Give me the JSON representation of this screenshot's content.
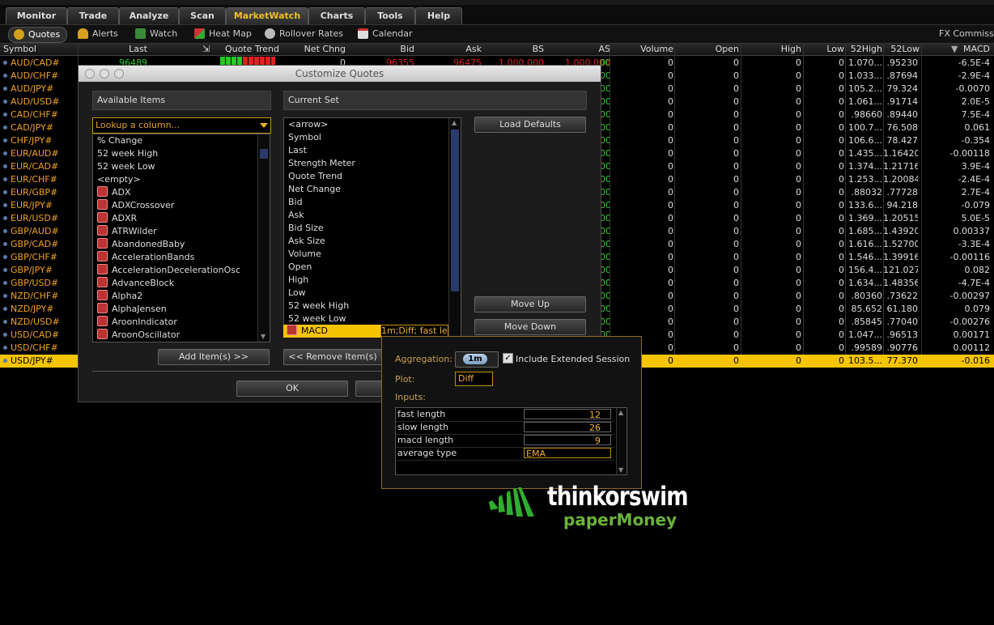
{
  "tabs": [
    "Monitor",
    "Trade",
    "Analyze",
    "Scan",
    "MarketWatch",
    "Charts",
    "Tools",
    "Help"
  ],
  "active_tab": "MarketWatch",
  "subtabs": [
    {
      "label": "Quotes",
      "icon": "quotes-icon"
    },
    {
      "label": "Alerts",
      "icon": "bell-icon"
    },
    {
      "label": "Watch",
      "icon": "watch-icon"
    },
    {
      "label": "Heat Map",
      "icon": "heatmap-icon"
    },
    {
      "label": "Rollover Rates",
      "icon": "rollover-icon"
    },
    {
      "label": "Calendar",
      "icon": "calendar-icon"
    }
  ],
  "fx_label": "FX Commissi",
  "columns": [
    "Symbol",
    "Last",
    "Quote Trend",
    "Net Chng",
    "Bid",
    "Ask",
    "BS",
    "AS",
    "Volume",
    "Open",
    "High",
    "Low",
    "52High",
    "52Low",
    "MACD"
  ],
  "first_row": {
    "last": "96489",
    "net": "0",
    "bid": "96355",
    "ask": "96475",
    "bs": "1,000,000",
    "as": "1,000,000"
  },
  "rows": [
    {
      "symbol": "AUD/CAD#",
      "volume": "0",
      "open": "0",
      "high": "0",
      "low": "0",
      "h52": "1.070...",
      "l52": ".95230",
      "macd": "-6.5E-4"
    },
    {
      "symbol": "AUD/CHF#",
      "volume": "0",
      "open": "0",
      "high": "0",
      "low": "0",
      "h52": "1.033...",
      "l52": ".87694",
      "macd": "-2.9E-4"
    },
    {
      "symbol": "AUD/JPY#",
      "volume": "0",
      "open": "0",
      "high": "0",
      "low": "0",
      "h52": "105.2...",
      "l52": "79.324",
      "macd": "-0.0070"
    },
    {
      "symbol": "AUD/USD#",
      "volume": "0",
      "open": "0",
      "high": "0",
      "low": "0",
      "h52": "1.061...",
      "l52": ".91714",
      "macd": "2.0E-5"
    },
    {
      "symbol": "CAD/CHF#",
      "volume": "0",
      "open": "0",
      "high": "0",
      "low": "0",
      "h52": ".98660",
      "l52": ".89440",
      "macd": "7.5E-4"
    },
    {
      "symbol": "CAD/JPY#",
      "volume": "0",
      "open": "0",
      "high": "0",
      "low": "0",
      "h52": "100.7...",
      "l52": "76.508",
      "macd": "0.061"
    },
    {
      "symbol": "CHF/JPY#",
      "volume": "0",
      "open": "0",
      "high": "0",
      "low": "0",
      "h52": "106.6...",
      "l52": "78.427",
      "macd": "-0.354"
    },
    {
      "symbol": "EUR/AUD#",
      "volume": "0",
      "open": "0",
      "high": "0",
      "low": "0",
      "h52": "1.435...",
      "l52": "1.16420",
      "macd": "-0.00118"
    },
    {
      "symbol": "EUR/CAD#",
      "volume": "0",
      "open": "0",
      "high": "0",
      "low": "0",
      "h52": "1.374...",
      "l52": "1.21716",
      "macd": "3.9E-4"
    },
    {
      "symbol": "EUR/CHF#",
      "volume": "0",
      "open": "0",
      "high": "0",
      "low": "0",
      "h52": "1.253...",
      "l52": "1.20084",
      "macd": "-2.4E-4"
    },
    {
      "symbol": "EUR/GBP#",
      "volume": "0",
      "open": "0",
      "high": "0",
      "low": "0",
      "h52": ".88032",
      "l52": ".77728",
      "macd": "2.7E-4"
    },
    {
      "symbol": "EUR/JPY#",
      "volume": "0",
      "open": "0",
      "high": "0",
      "low": "0",
      "h52": "133.6...",
      "l52": "94.218",
      "macd": "-0.079"
    },
    {
      "symbol": "EUR/USD#",
      "volume": "0",
      "open": "0",
      "high": "0",
      "low": "0",
      "h52": "1.369...",
      "l52": "1.20515",
      "macd": "5.0E-5"
    },
    {
      "symbol": "GBP/AUD#",
      "volume": "0",
      "open": "0",
      "high": "0",
      "low": "0",
      "h52": "1.685...",
      "l52": "1.43920",
      "macd": "0.00337"
    },
    {
      "symbol": "GBP/CAD#",
      "volume": "0",
      "open": "0",
      "high": "0",
      "low": "0",
      "h52": "1.616...",
      "l52": "1.52700",
      "macd": "-3.3E-4"
    },
    {
      "symbol": "GBP/CHF#",
      "volume": "0",
      "open": "0",
      "high": "0",
      "low": "0",
      "h52": "1.546...",
      "l52": "1.39916",
      "macd": "-0.00116"
    },
    {
      "symbol": "GBP/JPY#",
      "volume": "0",
      "open": "0",
      "high": "0",
      "low": "0",
      "h52": "156.4...",
      "l52": "121.027",
      "macd": "0.082"
    },
    {
      "symbol": "GBP/USD#",
      "volume": "0",
      "open": "0",
      "high": "0",
      "low": "0",
      "h52": "1.634...",
      "l52": "1.48356",
      "macd": "-4.7E-4"
    },
    {
      "symbol": "NZD/CHF#",
      "volume": "0",
      "open": "0",
      "high": "0",
      "low": "0",
      "h52": ".80360",
      "l52": ".73622",
      "macd": "-0.00297"
    },
    {
      "symbol": "NZD/JPY#",
      "volume": "0",
      "open": "0",
      "high": "0",
      "low": "0",
      "h52": "85.652",
      "l52": "61.180",
      "macd": "0.079"
    },
    {
      "symbol": "NZD/USD#",
      "volume": "0",
      "open": "0",
      "high": "0",
      "low": "0",
      "h52": ".85845",
      "l52": ".77040",
      "macd": "-0.00276"
    },
    {
      "symbol": "USD/CAD#",
      "volume": "0",
      "open": "0",
      "high": "0",
      "low": "0",
      "h52": "1.047...",
      "l52": ".96513",
      "macd": "0.00171"
    },
    {
      "symbol": "USD/CHF#",
      "volume": "0",
      "open": "0",
      "high": "0",
      "low": "0",
      "h52": ".99589",
      "l52": ".90776",
      "macd": "0.00112"
    },
    {
      "symbol": "USD/JPY#",
      "volume": "0",
      "open": "0",
      "high": "0",
      "low": "0",
      "h52": "103.5...",
      "l52": "77.370",
      "macd": "-0.016",
      "selected": true
    }
  ],
  "left_values": [
    "00",
    "00",
    "00",
    "00",
    "00",
    "00",
    "00",
    "00",
    "00",
    "00",
    "00",
    "00",
    "00",
    "00",
    "00",
    "00",
    "00",
    "00",
    "00",
    "00",
    "00",
    "00",
    "00"
  ],
  "dialog": {
    "title": "Customize Quotes",
    "available_header": "Available Items",
    "current_header": "Current Set",
    "lookup_placeholder": "Lookup a column...",
    "available_items": [
      {
        "label": "% Change",
        "study": false
      },
      {
        "label": "52 week High",
        "study": false
      },
      {
        "label": "52 week Low",
        "study": false
      },
      {
        "label": "<empty>",
        "study": false
      },
      {
        "label": "ADX",
        "study": true
      },
      {
        "label": "ADXCrossover",
        "study": true
      },
      {
        "label": "ADXR",
        "study": true
      },
      {
        "label": "ATRWilder",
        "study": true
      },
      {
        "label": "AbandonedBaby",
        "study": true
      },
      {
        "label": "AccelerationBands",
        "study": true
      },
      {
        "label": "AccelerationDecelerationOsc",
        "study": true
      },
      {
        "label": "AdvanceBlock",
        "study": true
      },
      {
        "label": "Alpha2",
        "study": true
      },
      {
        "label": "AlphaJensen",
        "study": true
      },
      {
        "label": "AroonIndicator",
        "study": true
      },
      {
        "label": "AroonOscillator",
        "study": true
      }
    ],
    "current_items": [
      "<arrow>",
      "Symbol",
      "Last",
      "Strength Meter",
      "Quote Trend",
      "Net Change",
      "Bid",
      "Ask",
      "Bid Size",
      "Ask Size",
      "Volume",
      "Open",
      "High",
      "Low",
      "52 week High",
      "52 week Low"
    ],
    "current_selected": {
      "label": "MACD",
      "detail": "1m;Diff; fast le"
    },
    "load_defaults": "Load Defaults",
    "move_up": "Move Up",
    "move_down": "Move Down",
    "add_items": "Add Item(s) >>",
    "remove_items": "<< Remove Item(s)",
    "ok": "OK"
  },
  "popup": {
    "aggregation_label": "Aggregation:",
    "aggregation_value": "1m",
    "include_extended": "Include Extended Session",
    "include_extended_checked": true,
    "plot_label": "Plot:",
    "plot_value": "Diff",
    "inputs_label": "Inputs:",
    "inputs": [
      {
        "name": "fast length",
        "value": "12"
      },
      {
        "name": "slow length",
        "value": "26"
      },
      {
        "name": "macd length",
        "value": "9"
      },
      {
        "name": "average type",
        "value": "EMA"
      }
    ]
  },
  "logo": {
    "name": "thinkorswim",
    "sub": "paperMoney"
  }
}
